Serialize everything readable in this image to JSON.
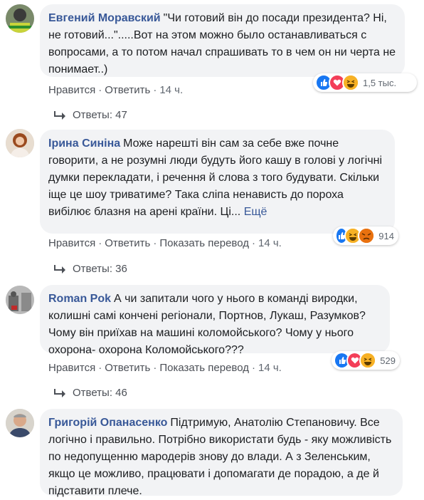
{
  "comments": [
    {
      "author": "Евгений Моравский",
      "text": "\"Чи готовий він до посади президента? Ні, не готовий...\".....Вот на этом можно было останавливаться с вопросами, а то потом начал спрашивать то в чем он ни черта не понимает..)",
      "actions": {
        "like": "Нравится",
        "reply": "Ответить",
        "time": "14 ч."
      },
      "reactions": {
        "icons": [
          "like-icon",
          "love-icon",
          "haha-icon"
        ],
        "count": "1,5 тыс."
      },
      "replies": "Ответы: 47"
    },
    {
      "author": "Ірина Синіна",
      "text": "Може нарешті він сам за себе вже почне говорити, а не розумні люди будуть його кашу в голові у логічні думки перекладати, і речення й слова з того будувати. Скільки іще це шоу триватиме? Така сліпа ненависть до пороха вибілює блазня на арені країни. Ці...",
      "more": "Ещё",
      "actions": {
        "like": "Нравится",
        "reply": "Ответить",
        "translate": "Показать перевод",
        "time": "14 ч."
      },
      "reactions": {
        "icons": [
          "like-icon",
          "haha-icon",
          "angry-icon"
        ],
        "count": "914"
      },
      "replies": "Ответы: 36"
    },
    {
      "author": "Roman Pok",
      "text": "А чи запитали чого у нього в команді виродки, колишні самі кончені регіонали, Портнов, Лукаш, Разумков? Чому він приїхав на машині коломойського? Чому у нього охорона- охорона Коломойського???",
      "actions": {
        "like": "Нравится",
        "reply": "Ответить",
        "translate": "Показать перевод",
        "time": "14 ч."
      },
      "reactions": {
        "icons": [
          "like-icon",
          "love-icon",
          "haha-icon"
        ],
        "count": "529"
      },
      "replies": "Ответы: 46"
    },
    {
      "author": "Григорій Опанасенко",
      "text": "Підтримую, Анатолію Степановичу. Все логічно і правильно. Потрібно використати будь - яку можливість по недопущенню мародерів знову до влади. А з Зеленським, якщо це можливо, працювати і допомагати де порадою, а де й підставити плече."
    }
  ],
  "colors": {
    "author": "#385898",
    "bubble": "#f2f3f5",
    "meta": "#606770"
  }
}
